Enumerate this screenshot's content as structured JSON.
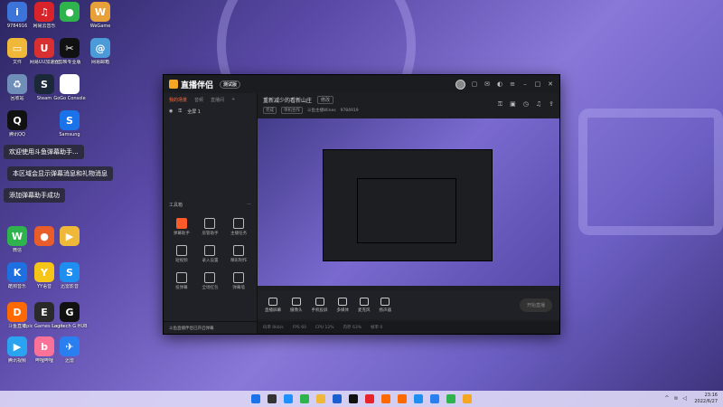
{
  "desktop": {
    "icons": [
      {
        "label": "9784916",
        "color": "#3c74d9",
        "glyph": "i"
      },
      {
        "label": "网易云音乐",
        "color": "#d8232a",
        "glyph": "♫"
      },
      {
        "label": "",
        "color": "#2fb34c",
        "glyph": "●"
      },
      {
        "label": "WeGame",
        "color": "#e8a13a",
        "glyph": "W"
      },
      {
        "label": "文件",
        "color": "#f0b838",
        "glyph": "▭"
      },
      {
        "label": "网易UU加速器",
        "color": "#d83030",
        "glyph": "U"
      },
      {
        "label": "剪映专业版",
        "color": "#111111",
        "glyph": "✂"
      },
      {
        "label": "网易邮箱",
        "color": "#4c9ad8",
        "glyph": "@"
      },
      {
        "label": "回收站",
        "color": "#6f8fb8",
        "glyph": "♻"
      },
      {
        "label": "Steam",
        "color": "#1b2838",
        "glyph": "S"
      },
      {
        "label": "GoGo Console",
        "color": "#ffffff",
        "glyph": "◎"
      },
      {
        "label": "腾讯QQ",
        "color": "#111111",
        "glyph": "Q"
      },
      {
        "label": "Samsung",
        "color": "#1a73e8",
        "glyph": "S"
      },
      {
        "label": "微信",
        "color": "#2fb34c",
        "glyph": "W"
      },
      {
        "label": "",
        "color": "#e85d2a",
        "glyph": "●"
      },
      {
        "label": "",
        "color": "#f0b838",
        "glyph": "▶"
      },
      {
        "label": "酷狗音乐",
        "color": "#1e6fe0",
        "glyph": "K"
      },
      {
        "label": "YY语音",
        "color": "#f5c518",
        "glyph": "Y"
      },
      {
        "label": "迅雷影音",
        "color": "#1e8ef0",
        "glyph": "S"
      },
      {
        "label": "斗鱼直播",
        "color": "#ff6a00",
        "glyph": "D"
      },
      {
        "label": "Epic Games Launcher",
        "color": "#2a2a2a",
        "glyph": "E"
      },
      {
        "label": "Logitech G HUB",
        "color": "#111111",
        "glyph": "G"
      },
      {
        "label": "腾讯视频",
        "color": "#2aa3f0",
        "glyph": "▶"
      },
      {
        "label": "哔哩哔哩",
        "color": "#fb7299",
        "glyph": "b"
      },
      {
        "label": "迅雷",
        "color": "#2a7ff0",
        "glyph": "✈"
      }
    ]
  },
  "toasts": [
    {
      "text": "欢迎使用斗鱼弹幕助手..."
    },
    {
      "text": "本区域会显示弹幕消息和礼物消息"
    },
    {
      "text": "添加弹幕助手成功"
    }
  ],
  "app": {
    "title": "直播伴侣",
    "version_badge": "测试版",
    "room_title": "重新减少的看新山庄",
    "edit_label": "修改",
    "room_tags": [
      "完成",
      "单机合作",
      "斗鱼主播Wines",
      "9784919"
    ],
    "left_tabs": [
      "我的场景",
      "音频",
      "直播间",
      "+"
    ],
    "scene_row": [
      "全屏 1"
    ],
    "tools_heading": "工具箱",
    "tools": [
      {
        "label": "弹幕助手",
        "hot": true
      },
      {
        "label": "房管助手",
        "hot": false
      },
      {
        "label": "主播任务",
        "hot": false
      },
      {
        "label": "短视频",
        "hot": false
      },
      {
        "label": "录入设置",
        "hot": false
      },
      {
        "label": "精彩制作",
        "hot": false
      },
      {
        "label": "投弹幕",
        "hot": false
      },
      {
        "label": "全场红包",
        "hot": false
      },
      {
        "label": "弹幕墙",
        "hot": false
      }
    ],
    "left_footer": "斗鱼直播伴侣已开启弹幕",
    "bottom_controls": [
      "直播屏幕",
      "摄像头",
      "手机投屏",
      "多媒体",
      "麦克风",
      "扬声器"
    ],
    "start_button": "开始直播",
    "status": [
      "码率 0kb/s",
      "FPS 60",
      "CPU 12%",
      "内存 63%",
      "帧率 0"
    ]
  },
  "taskbar": {
    "time": "23:16",
    "date": "2022/6/27"
  }
}
